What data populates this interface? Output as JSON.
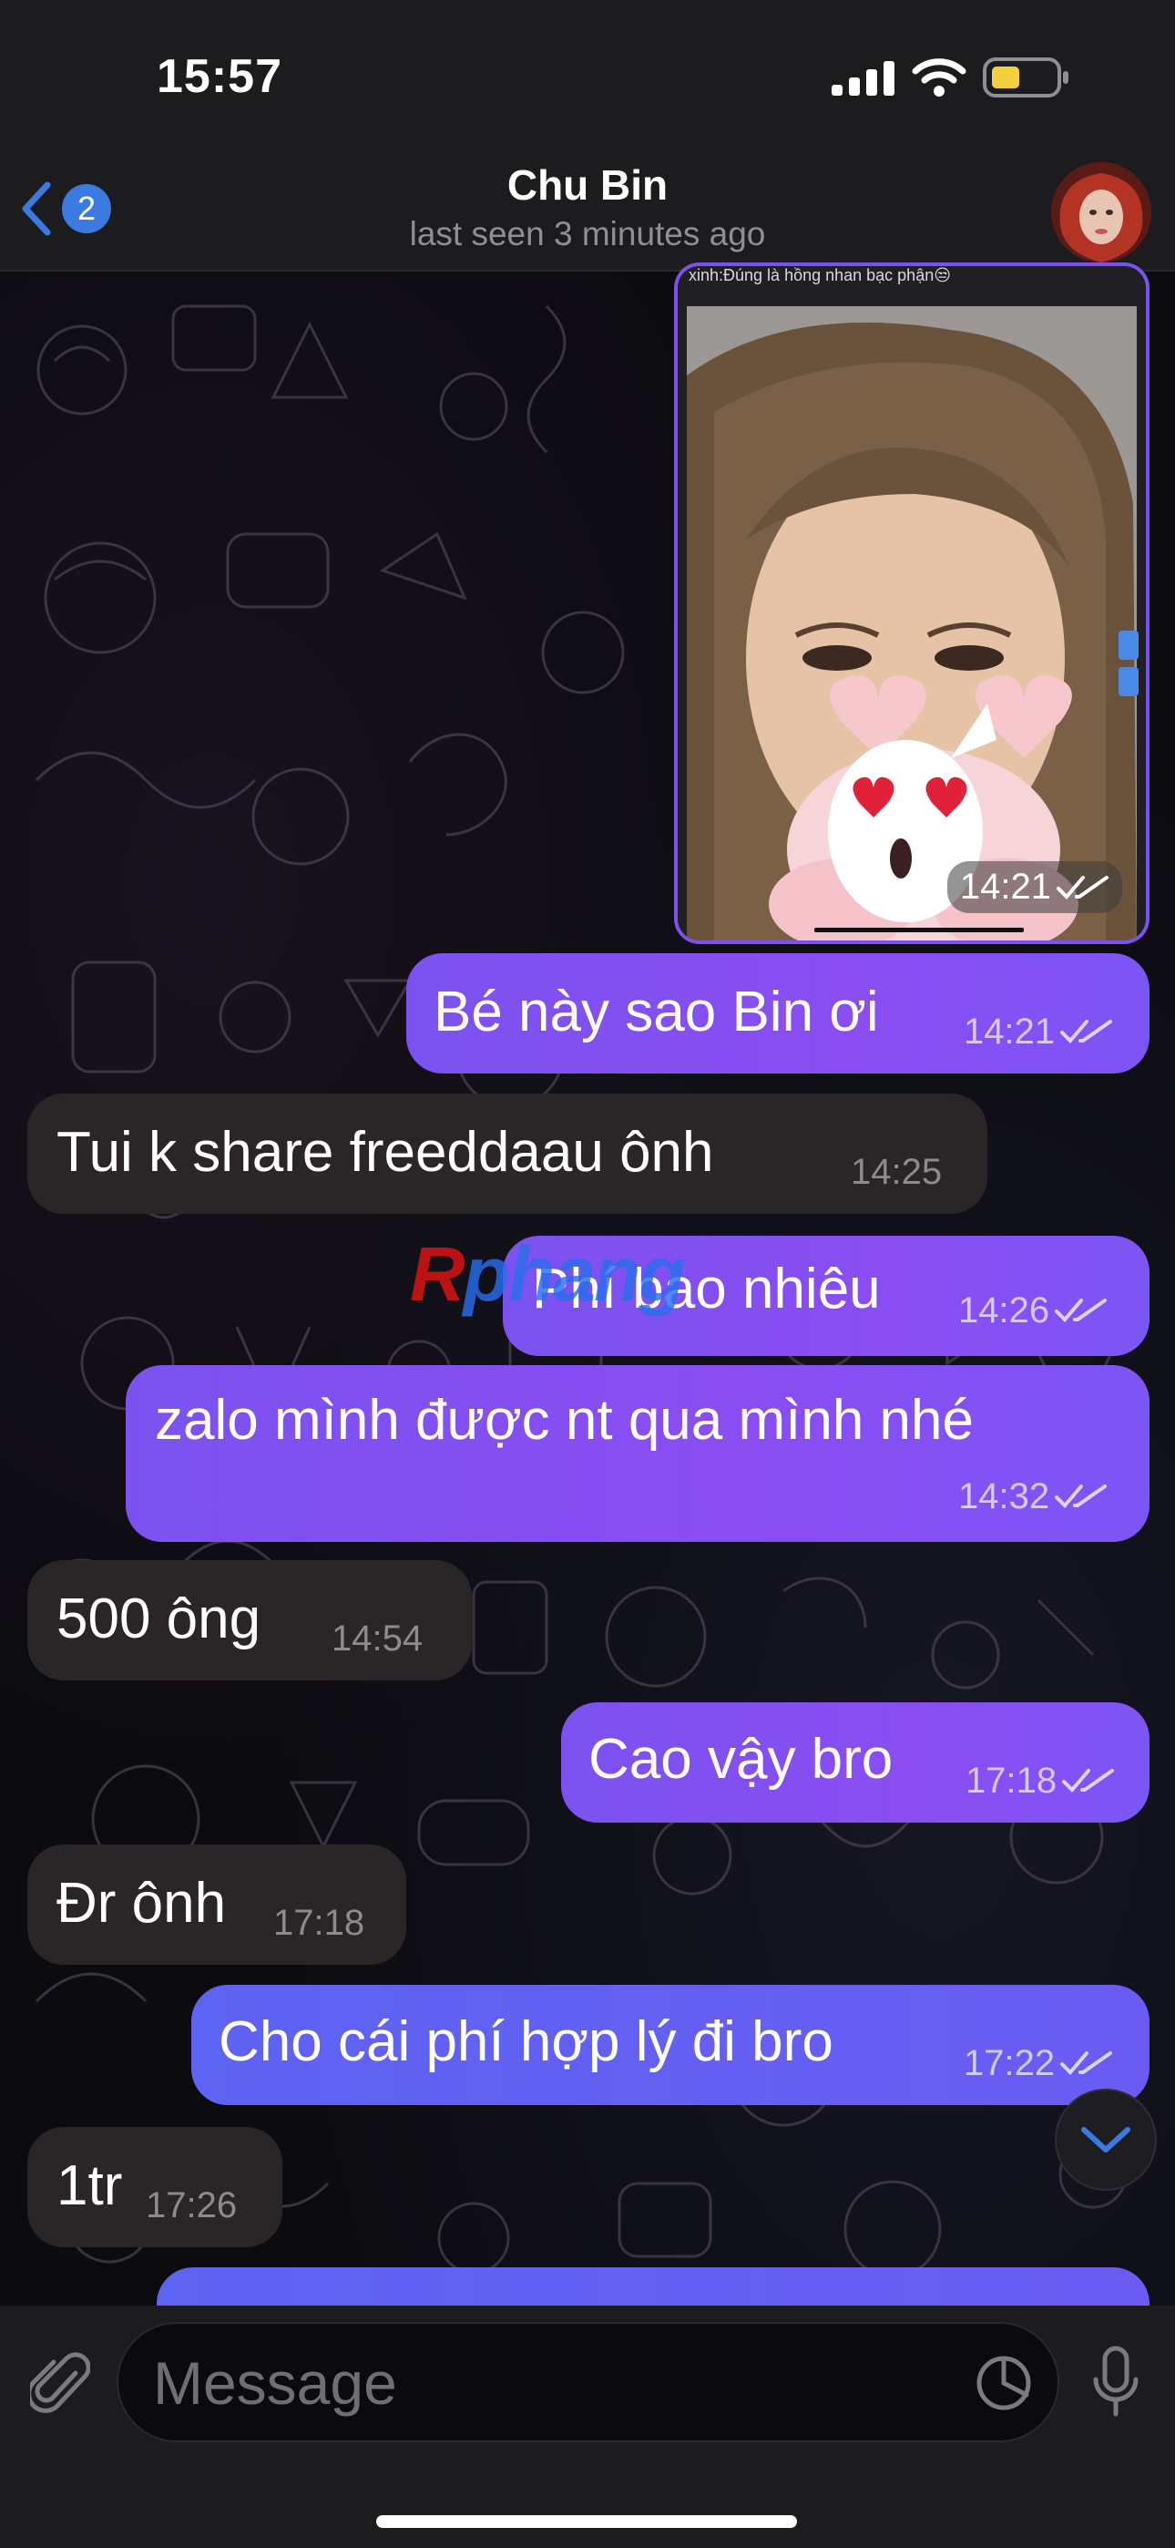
{
  "status_bar": {
    "time": "15:57"
  },
  "header": {
    "back_badge": "2",
    "title": "Chu Bin",
    "subtitle": "last seen 3 minutes ago"
  },
  "photo_message": {
    "caption": "xinh:Đúng là hồng nhan bạc phận😒",
    "time": "14:21",
    "watermark": "Rphang"
  },
  "messages": [
    {
      "dir": "out",
      "text": "Bé này sao Bin ơi",
      "time": "14:21"
    },
    {
      "dir": "in",
      "text": "Tui k share freeddaau ônh",
      "time": "14:25"
    },
    {
      "dir": "out",
      "text": "Phí bao nhiêu",
      "time": "14:26"
    },
    {
      "dir": "out",
      "text": "zalo mình được nt qua mình nhé",
      "time": "14:32"
    },
    {
      "dir": "in",
      "text": "500 ông",
      "time": "14:54"
    },
    {
      "dir": "out",
      "text": "Cao vậy bro",
      "time": "17:18"
    },
    {
      "dir": "in",
      "text": "Đr ônh",
      "time": "17:18"
    },
    {
      "dir": "out",
      "text": "Cho cái phí hợp lý đi bro",
      "time": "17:22"
    },
    {
      "dir": "in",
      "text": "1tr",
      "time": "17:26"
    }
  ],
  "watermark": {
    "first": "R",
    "rest": "phang"
  },
  "input": {
    "placeholder": "Message"
  },
  "colors": {
    "outgoing_bubble": "#7b52f0",
    "incoming_bubble": "#2a2526",
    "accent": "#3b7ae0"
  },
  "icons": [
    "back-chevron-icon",
    "paperclip-icon",
    "sticker-icon",
    "microphone-icon",
    "chevron-down-icon",
    "double-check-icon"
  ]
}
